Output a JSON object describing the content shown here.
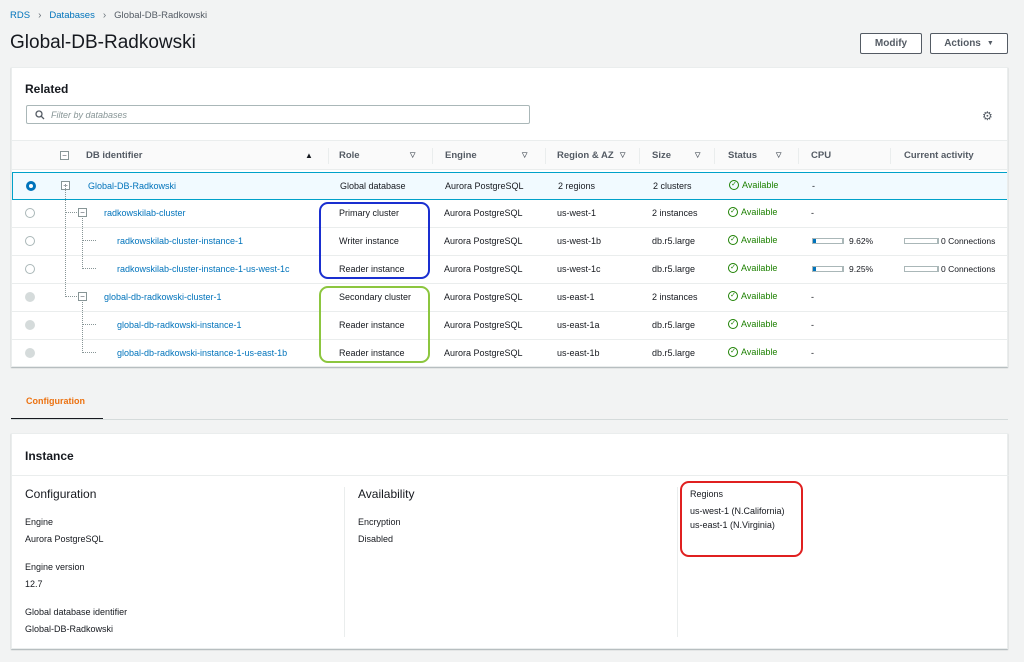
{
  "breadcrumb": {
    "root": "RDS",
    "parent": "Databases",
    "current": "Global-DB-Radkowski"
  },
  "page_title": "Global-DB-Radkowski",
  "buttons": {
    "modify": "Modify",
    "actions": "Actions"
  },
  "related": {
    "title": "Related",
    "filter_placeholder": "Filter by databases",
    "columns": [
      "DB identifier",
      "Role",
      "Engine",
      "Region & AZ",
      "Size",
      "Status",
      "CPU",
      "Current activity"
    ],
    "rows": [
      {
        "id": "Global-DB-Radkowski",
        "role": "Global database",
        "engine": "Aurora PostgreSQL",
        "region": "2 regions",
        "size": "2 clusters",
        "status": "Available",
        "cpu": "-",
        "activity": ""
      },
      {
        "id": "radkowskilab-cluster",
        "role": "Primary cluster",
        "engine": "Aurora PostgreSQL",
        "region": "us-west-1",
        "size": "2 instances",
        "status": "Available",
        "cpu": "-",
        "activity": ""
      },
      {
        "id": "radkowskilab-cluster-instance-1",
        "role": "Writer instance",
        "engine": "Aurora PostgreSQL",
        "region": "us-west-1b",
        "size": "db.r5.large",
        "status": "Available",
        "cpu": "9.62%",
        "cpu_fraction": 0.0962,
        "activity": "0 Connections"
      },
      {
        "id": "radkowskilab-cluster-instance-1-us-west-1c",
        "role": "Reader instance",
        "engine": "Aurora PostgreSQL",
        "region": "us-west-1c",
        "size": "db.r5.large",
        "status": "Available",
        "cpu": "9.25%",
        "cpu_fraction": 0.0925,
        "activity": "0 Connections"
      },
      {
        "id": "global-db-radkowski-cluster-1",
        "role": "Secondary cluster",
        "engine": "Aurora PostgreSQL",
        "region": "us-east-1",
        "size": "2 instances",
        "status": "Available",
        "cpu": "-",
        "activity": ""
      },
      {
        "id": "global-db-radkowski-instance-1",
        "role": "Reader instance",
        "engine": "Aurora PostgreSQL",
        "region": "us-east-1a",
        "size": "db.r5.large",
        "status": "Available",
        "cpu": "-",
        "activity": ""
      },
      {
        "id": "global-db-radkowski-instance-1-us-east-1b",
        "role": "Reader instance",
        "engine": "Aurora PostgreSQL",
        "region": "us-east-1b",
        "size": "db.r5.large",
        "status": "Available",
        "cpu": "-",
        "activity": ""
      }
    ]
  },
  "tabs": {
    "configuration": "Configuration"
  },
  "instance": {
    "title": "Instance",
    "configuration": {
      "heading": "Configuration",
      "engine_label": "Engine",
      "engine_value": "Aurora PostgreSQL",
      "version_label": "Engine version",
      "version_value": "12.7",
      "gid_label": "Global database identifier",
      "gid_value": "Global-DB-Radkowski"
    },
    "availability": {
      "heading": "Availability",
      "encryption_label": "Encryption",
      "encryption_value": "Disabled"
    },
    "regions": {
      "label": "Regions",
      "values": [
        "us-west-1 (N.California)",
        "us-east-1 (N.Virginia)"
      ]
    }
  },
  "colors": {
    "link": "#0073bb",
    "available": "#1d8102",
    "tab_active": "#ec7211",
    "highlight_primary": "#1a2fd0",
    "highlight_secondary": "#8cc63f",
    "highlight_regions": "#e02020"
  }
}
